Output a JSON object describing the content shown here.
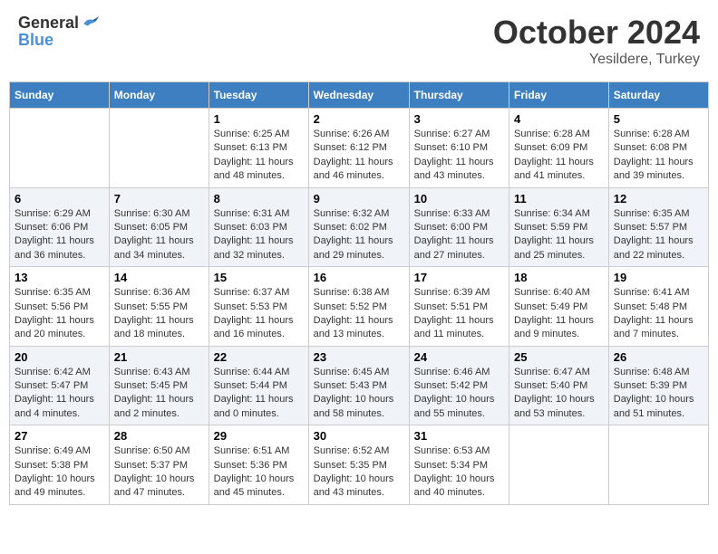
{
  "header": {
    "logo_general": "General",
    "logo_blue": "Blue",
    "month": "October 2024",
    "location": "Yesildere, Turkey"
  },
  "weekdays": [
    "Sunday",
    "Monday",
    "Tuesday",
    "Wednesday",
    "Thursday",
    "Friday",
    "Saturday"
  ],
  "weeks": [
    [
      {
        "day": "",
        "info": ""
      },
      {
        "day": "",
        "info": ""
      },
      {
        "day": "1",
        "info": "Sunrise: 6:25 AM\nSunset: 6:13 PM\nDaylight: 11 hours and 48 minutes."
      },
      {
        "day": "2",
        "info": "Sunrise: 6:26 AM\nSunset: 6:12 PM\nDaylight: 11 hours and 46 minutes."
      },
      {
        "day": "3",
        "info": "Sunrise: 6:27 AM\nSunset: 6:10 PM\nDaylight: 11 hours and 43 minutes."
      },
      {
        "day": "4",
        "info": "Sunrise: 6:28 AM\nSunset: 6:09 PM\nDaylight: 11 hours and 41 minutes."
      },
      {
        "day": "5",
        "info": "Sunrise: 6:28 AM\nSunset: 6:08 PM\nDaylight: 11 hours and 39 minutes."
      }
    ],
    [
      {
        "day": "6",
        "info": "Sunrise: 6:29 AM\nSunset: 6:06 PM\nDaylight: 11 hours and 36 minutes."
      },
      {
        "day": "7",
        "info": "Sunrise: 6:30 AM\nSunset: 6:05 PM\nDaylight: 11 hours and 34 minutes."
      },
      {
        "day": "8",
        "info": "Sunrise: 6:31 AM\nSunset: 6:03 PM\nDaylight: 11 hours and 32 minutes."
      },
      {
        "day": "9",
        "info": "Sunrise: 6:32 AM\nSunset: 6:02 PM\nDaylight: 11 hours and 29 minutes."
      },
      {
        "day": "10",
        "info": "Sunrise: 6:33 AM\nSunset: 6:00 PM\nDaylight: 11 hours and 27 minutes."
      },
      {
        "day": "11",
        "info": "Sunrise: 6:34 AM\nSunset: 5:59 PM\nDaylight: 11 hours and 25 minutes."
      },
      {
        "day": "12",
        "info": "Sunrise: 6:35 AM\nSunset: 5:57 PM\nDaylight: 11 hours and 22 minutes."
      }
    ],
    [
      {
        "day": "13",
        "info": "Sunrise: 6:35 AM\nSunset: 5:56 PM\nDaylight: 11 hours and 20 minutes."
      },
      {
        "day": "14",
        "info": "Sunrise: 6:36 AM\nSunset: 5:55 PM\nDaylight: 11 hours and 18 minutes."
      },
      {
        "day": "15",
        "info": "Sunrise: 6:37 AM\nSunset: 5:53 PM\nDaylight: 11 hours and 16 minutes."
      },
      {
        "day": "16",
        "info": "Sunrise: 6:38 AM\nSunset: 5:52 PM\nDaylight: 11 hours and 13 minutes."
      },
      {
        "day": "17",
        "info": "Sunrise: 6:39 AM\nSunset: 5:51 PM\nDaylight: 11 hours and 11 minutes."
      },
      {
        "day": "18",
        "info": "Sunrise: 6:40 AM\nSunset: 5:49 PM\nDaylight: 11 hours and 9 minutes."
      },
      {
        "day": "19",
        "info": "Sunrise: 6:41 AM\nSunset: 5:48 PM\nDaylight: 11 hours and 7 minutes."
      }
    ],
    [
      {
        "day": "20",
        "info": "Sunrise: 6:42 AM\nSunset: 5:47 PM\nDaylight: 11 hours and 4 minutes."
      },
      {
        "day": "21",
        "info": "Sunrise: 6:43 AM\nSunset: 5:45 PM\nDaylight: 11 hours and 2 minutes."
      },
      {
        "day": "22",
        "info": "Sunrise: 6:44 AM\nSunset: 5:44 PM\nDaylight: 11 hours and 0 minutes."
      },
      {
        "day": "23",
        "info": "Sunrise: 6:45 AM\nSunset: 5:43 PM\nDaylight: 10 hours and 58 minutes."
      },
      {
        "day": "24",
        "info": "Sunrise: 6:46 AM\nSunset: 5:42 PM\nDaylight: 10 hours and 55 minutes."
      },
      {
        "day": "25",
        "info": "Sunrise: 6:47 AM\nSunset: 5:40 PM\nDaylight: 10 hours and 53 minutes."
      },
      {
        "day": "26",
        "info": "Sunrise: 6:48 AM\nSunset: 5:39 PM\nDaylight: 10 hours and 51 minutes."
      }
    ],
    [
      {
        "day": "27",
        "info": "Sunrise: 6:49 AM\nSunset: 5:38 PM\nDaylight: 10 hours and 49 minutes."
      },
      {
        "day": "28",
        "info": "Sunrise: 6:50 AM\nSunset: 5:37 PM\nDaylight: 10 hours and 47 minutes."
      },
      {
        "day": "29",
        "info": "Sunrise: 6:51 AM\nSunset: 5:36 PM\nDaylight: 10 hours and 45 minutes."
      },
      {
        "day": "30",
        "info": "Sunrise: 6:52 AM\nSunset: 5:35 PM\nDaylight: 10 hours and 43 minutes."
      },
      {
        "day": "31",
        "info": "Sunrise: 6:53 AM\nSunset: 5:34 PM\nDaylight: 10 hours and 40 minutes."
      },
      {
        "day": "",
        "info": ""
      },
      {
        "day": "",
        "info": ""
      }
    ]
  ]
}
